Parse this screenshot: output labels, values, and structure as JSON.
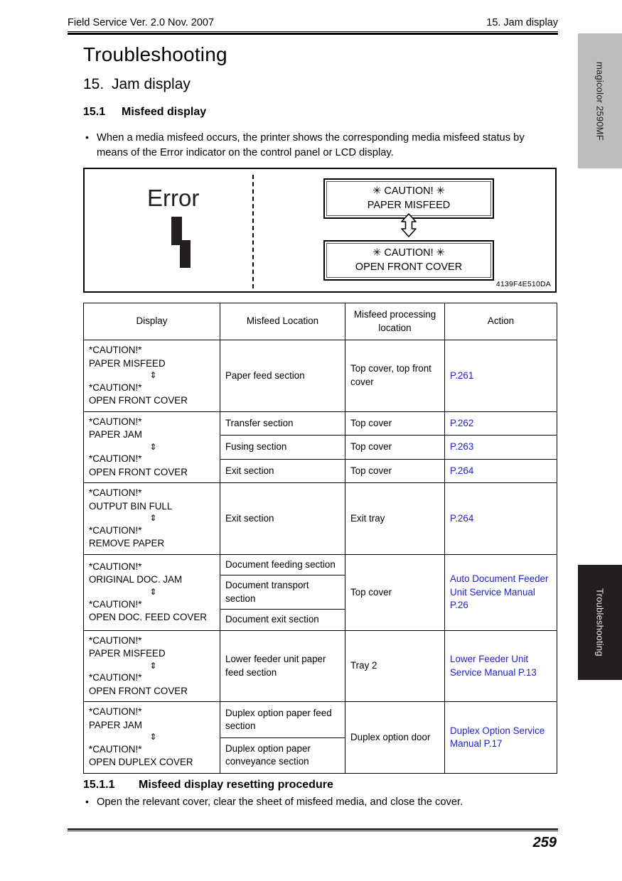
{
  "header": {
    "left": "Field Service Ver. 2.0 Nov. 2007",
    "right": "15. Jam display"
  },
  "side_tabs": {
    "product": "magicolor 2590MF",
    "chapter": "Troubleshooting"
  },
  "titles": {
    "doc_title": "Troubleshooting",
    "section_number": "15.",
    "section_name": "Jam display",
    "subsection_number": "15.1",
    "subsection_name": "Misfeed display",
    "subsubsection_number": "15.1.1",
    "subsubsection_name": "Misfeed display resetting procedure"
  },
  "bullets": {
    "intro": "When a media misfeed occurs, the printer shows the corresponding media misfeed status by means of the Error indicator on the control panel or LCD display.",
    "reset": "Open the relevant cover, clear the sheet of misfeed media, and close the cover.",
    "marker": "•"
  },
  "figure": {
    "error_label": "Error",
    "error_glyph_name": "jam-indicator-glyph",
    "lcd_top_line1": "✳ CAUTION! ✳",
    "lcd_top_line2": "PAPER MISFEED",
    "lcd_bottom_line1": "✳ CAUTION! ✳",
    "lcd_bottom_line2": "OPEN FRONT COVER",
    "arrow_name": "up-down-arrow-icon",
    "code": "4139F4E510DA"
  },
  "table": {
    "headers": [
      "Display",
      "Misfeed Location",
      "Misfeed processing location",
      "Action"
    ],
    "arrow": "⇕",
    "groups": [
      {
        "display": [
          "*CAUTION!*",
          "PAPER MISFEED",
          "⇕",
          "*CAUTION!*",
          "OPEN FRONT COVER"
        ],
        "rows": [
          {
            "location": "Paper feed section",
            "processing": "Top cover, top front cover",
            "action": "P.261",
            "action_is_link": true
          }
        ]
      },
      {
        "display": [
          "*CAUTION!*",
          "PAPER JAM",
          "⇕",
          "*CAUTION!*",
          "OPEN FRONT COVER"
        ],
        "rows": [
          {
            "location": "Transfer section",
            "processing": "Top cover",
            "action": "P.262",
            "action_is_link": true
          },
          {
            "location": "Fusing section",
            "processing": "Top cover",
            "action": "P.263",
            "action_is_link": true
          },
          {
            "location": "Exit section",
            "processing": "Top cover",
            "action": "P.264",
            "action_is_link": true
          }
        ]
      },
      {
        "display": [
          "*CAUTION!*",
          "OUTPUT BIN FULL",
          "⇕",
          "*CAUTION!*",
          "REMOVE PAPER"
        ],
        "rows": [
          {
            "location": "Exit section",
            "processing": "Exit tray",
            "action": "P.264",
            "action_is_link": true
          }
        ]
      },
      {
        "display": [
          "*CAUTION!*",
          "ORIGINAL DOC. JAM",
          "⇕",
          "*CAUTION!*",
          "OPEN DOC. FEED COVER"
        ],
        "rows": [
          {
            "location": "Document feeding section",
            "processing": "Top cover",
            "action": "Auto Document Feeder Unit Service Manual P.26",
            "action_is_link": true
          },
          {
            "location": "Document transport section"
          },
          {
            "location": "Document exit section"
          }
        ]
      },
      {
        "display": [
          "*CAUTION!*",
          "PAPER MISFEED",
          "⇕",
          "*CAUTION!*",
          "OPEN FRONT COVER"
        ],
        "rows": [
          {
            "location": "Lower feeder unit paper feed section",
            "processing": "Tray 2",
            "action": "Lower Feeder Unit Service Manual P.13",
            "action_is_link": true
          }
        ]
      },
      {
        "display": [
          "*CAUTION!*",
          "PAPER JAM",
          "⇕",
          "*CAUTION!*",
          "OPEN DUPLEX COVER"
        ],
        "rows": [
          {
            "location": "Duplex option paper feed section",
            "processing": "Duplex option door",
            "action": "Duplex Option Service Manual P.17",
            "action_is_link": true
          },
          {
            "location": "Duplex option paper conveyance section"
          }
        ]
      }
    ]
  },
  "footer": {
    "page_number": "259"
  },
  "colors": {
    "link": "#2222cc",
    "product_tab_bg": "#bdbdbd",
    "chapter_tab_bg": "#231f20"
  }
}
